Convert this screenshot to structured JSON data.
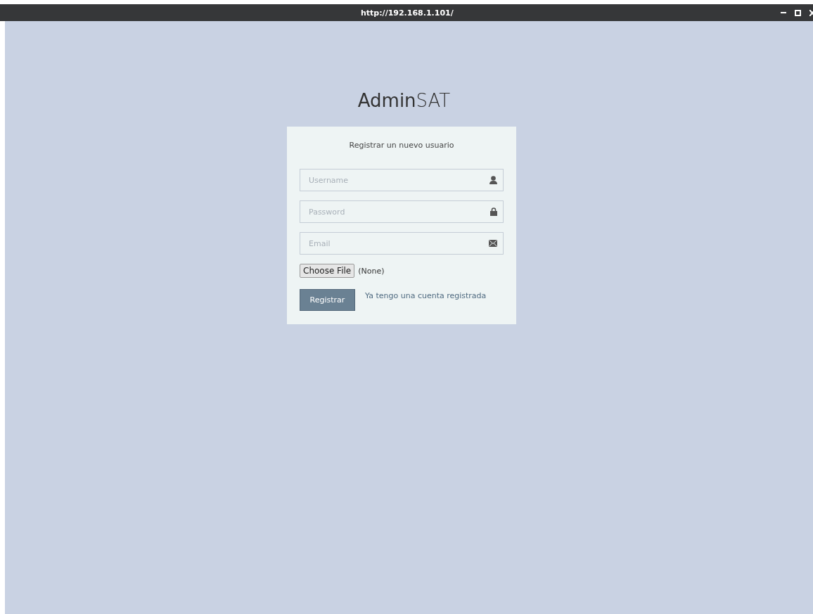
{
  "window": {
    "title": "http://192.168.1.101/"
  },
  "logo": "**Admin**SAT",
  "form": {
    "heading": "Registrar un nuevo usuario",
    "fields": [
      {
        "kind": "user",
        "placeholder": "Username"
      },
      {
        "kind": "lock",
        "placeholder": "Password"
      },
      {
        "kind": "email",
        "placeholder": "Email"
      }
    ],
    "file": {
      "button": "Choose File",
      "status": "(None)"
    },
    "submit": "Registrar",
    "link": "Ya tengo una cuenta registrada"
  }
}
